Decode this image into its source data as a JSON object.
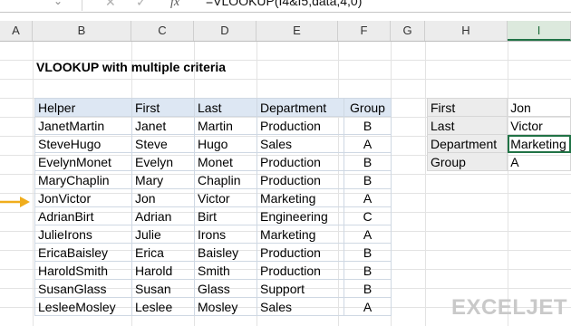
{
  "formula_bar": {
    "cancel_icon": "cancel-icon",
    "enter_icon": "enter-icon",
    "fx_label": "fx",
    "formula": "=VLOOKUP(I4&I5,data,4,0)"
  },
  "column_headers": [
    "A",
    "B",
    "C",
    "D",
    "E",
    "F",
    "G",
    "H",
    "I"
  ],
  "active_column": "I",
  "title": "VLOOKUP with multiple criteria",
  "data_table": {
    "headers": [
      "Helper",
      "First",
      "Last",
      "Department",
      "Group"
    ],
    "rows": [
      [
        "JanetMartin",
        "Janet",
        "Martin",
        "Production",
        "B"
      ],
      [
        "SteveHugo",
        "Steve",
        "Hugo",
        "Sales",
        "A"
      ],
      [
        "EvelynMonet",
        "Evelyn",
        "Monet",
        "Production",
        "B"
      ],
      [
        "MaryChaplin",
        "Mary",
        "Chaplin",
        "Production",
        "B"
      ],
      [
        "JonVictor",
        "Jon",
        "Victor",
        "Marketing",
        "A"
      ],
      [
        "AdrianBirt",
        "Adrian",
        "Birt",
        "Engineering",
        "C"
      ],
      [
        "JulieIrons",
        "Julie",
        "Irons",
        "Marketing",
        "A"
      ],
      [
        "EricaBaisley",
        "Erica",
        "Baisley",
        "Production",
        "B"
      ],
      [
        "HaroldSmith",
        "Harold",
        "Smith",
        "Production",
        "B"
      ],
      [
        "SusanGlass",
        "Susan",
        "Glass",
        "Support",
        "B"
      ],
      [
        "LesleeMosley",
        "Leslee",
        "Mosley",
        "Sales",
        "A"
      ]
    ]
  },
  "lookup_table": {
    "rows": [
      {
        "label": "First",
        "value": "Jon"
      },
      {
        "label": "Last",
        "value": "Victor"
      },
      {
        "label": "Department",
        "value": "Marketing"
      },
      {
        "label": "Group",
        "value": "A"
      }
    ],
    "selected_row": 2
  },
  "arrow": {
    "icon": "arrow-right-icon",
    "color": "#f0ad1c"
  },
  "colors": {
    "header_fill": "#dde7f3",
    "label_fill": "#ececec",
    "accent": "#217346"
  },
  "logo": "EXCELJET"
}
